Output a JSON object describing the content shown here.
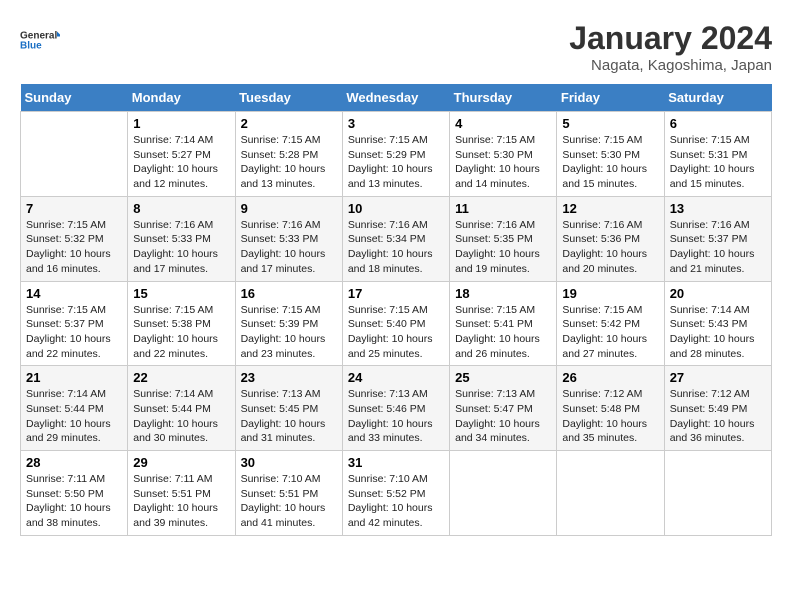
{
  "logo": {
    "line1": "General",
    "line2": "Blue"
  },
  "title": "January 2024",
  "subtitle": "Nagata, Kagoshima, Japan",
  "headers": [
    "Sunday",
    "Monday",
    "Tuesday",
    "Wednesday",
    "Thursday",
    "Friday",
    "Saturday"
  ],
  "weeks": [
    [
      {
        "day": "",
        "info": ""
      },
      {
        "day": "1",
        "info": "Sunrise: 7:14 AM\nSunset: 5:27 PM\nDaylight: 10 hours\nand 12 minutes."
      },
      {
        "day": "2",
        "info": "Sunrise: 7:15 AM\nSunset: 5:28 PM\nDaylight: 10 hours\nand 13 minutes."
      },
      {
        "day": "3",
        "info": "Sunrise: 7:15 AM\nSunset: 5:29 PM\nDaylight: 10 hours\nand 13 minutes."
      },
      {
        "day": "4",
        "info": "Sunrise: 7:15 AM\nSunset: 5:30 PM\nDaylight: 10 hours\nand 14 minutes."
      },
      {
        "day": "5",
        "info": "Sunrise: 7:15 AM\nSunset: 5:30 PM\nDaylight: 10 hours\nand 15 minutes."
      },
      {
        "day": "6",
        "info": "Sunrise: 7:15 AM\nSunset: 5:31 PM\nDaylight: 10 hours\nand 15 minutes."
      }
    ],
    [
      {
        "day": "7",
        "info": "Sunrise: 7:15 AM\nSunset: 5:32 PM\nDaylight: 10 hours\nand 16 minutes."
      },
      {
        "day": "8",
        "info": "Sunrise: 7:16 AM\nSunset: 5:33 PM\nDaylight: 10 hours\nand 17 minutes."
      },
      {
        "day": "9",
        "info": "Sunrise: 7:16 AM\nSunset: 5:33 PM\nDaylight: 10 hours\nand 17 minutes."
      },
      {
        "day": "10",
        "info": "Sunrise: 7:16 AM\nSunset: 5:34 PM\nDaylight: 10 hours\nand 18 minutes."
      },
      {
        "day": "11",
        "info": "Sunrise: 7:16 AM\nSunset: 5:35 PM\nDaylight: 10 hours\nand 19 minutes."
      },
      {
        "day": "12",
        "info": "Sunrise: 7:16 AM\nSunset: 5:36 PM\nDaylight: 10 hours\nand 20 minutes."
      },
      {
        "day": "13",
        "info": "Sunrise: 7:16 AM\nSunset: 5:37 PM\nDaylight: 10 hours\nand 21 minutes."
      }
    ],
    [
      {
        "day": "14",
        "info": "Sunrise: 7:15 AM\nSunset: 5:37 PM\nDaylight: 10 hours\nand 22 minutes."
      },
      {
        "day": "15",
        "info": "Sunrise: 7:15 AM\nSunset: 5:38 PM\nDaylight: 10 hours\nand 22 minutes."
      },
      {
        "day": "16",
        "info": "Sunrise: 7:15 AM\nSunset: 5:39 PM\nDaylight: 10 hours\nand 23 minutes."
      },
      {
        "day": "17",
        "info": "Sunrise: 7:15 AM\nSunset: 5:40 PM\nDaylight: 10 hours\nand 25 minutes."
      },
      {
        "day": "18",
        "info": "Sunrise: 7:15 AM\nSunset: 5:41 PM\nDaylight: 10 hours\nand 26 minutes."
      },
      {
        "day": "19",
        "info": "Sunrise: 7:15 AM\nSunset: 5:42 PM\nDaylight: 10 hours\nand 27 minutes."
      },
      {
        "day": "20",
        "info": "Sunrise: 7:14 AM\nSunset: 5:43 PM\nDaylight: 10 hours\nand 28 minutes."
      }
    ],
    [
      {
        "day": "21",
        "info": "Sunrise: 7:14 AM\nSunset: 5:44 PM\nDaylight: 10 hours\nand 29 minutes."
      },
      {
        "day": "22",
        "info": "Sunrise: 7:14 AM\nSunset: 5:44 PM\nDaylight: 10 hours\nand 30 minutes."
      },
      {
        "day": "23",
        "info": "Sunrise: 7:13 AM\nSunset: 5:45 PM\nDaylight: 10 hours\nand 31 minutes."
      },
      {
        "day": "24",
        "info": "Sunrise: 7:13 AM\nSunset: 5:46 PM\nDaylight: 10 hours\nand 33 minutes."
      },
      {
        "day": "25",
        "info": "Sunrise: 7:13 AM\nSunset: 5:47 PM\nDaylight: 10 hours\nand 34 minutes."
      },
      {
        "day": "26",
        "info": "Sunrise: 7:12 AM\nSunset: 5:48 PM\nDaylight: 10 hours\nand 35 minutes."
      },
      {
        "day": "27",
        "info": "Sunrise: 7:12 AM\nSunset: 5:49 PM\nDaylight: 10 hours\nand 36 minutes."
      }
    ],
    [
      {
        "day": "28",
        "info": "Sunrise: 7:11 AM\nSunset: 5:50 PM\nDaylight: 10 hours\nand 38 minutes."
      },
      {
        "day": "29",
        "info": "Sunrise: 7:11 AM\nSunset: 5:51 PM\nDaylight: 10 hours\nand 39 minutes."
      },
      {
        "day": "30",
        "info": "Sunrise: 7:10 AM\nSunset: 5:51 PM\nDaylight: 10 hours\nand 41 minutes."
      },
      {
        "day": "31",
        "info": "Sunrise: 7:10 AM\nSunset: 5:52 PM\nDaylight: 10 hours\nand 42 minutes."
      },
      {
        "day": "",
        "info": ""
      },
      {
        "day": "",
        "info": ""
      },
      {
        "day": "",
        "info": ""
      }
    ]
  ]
}
